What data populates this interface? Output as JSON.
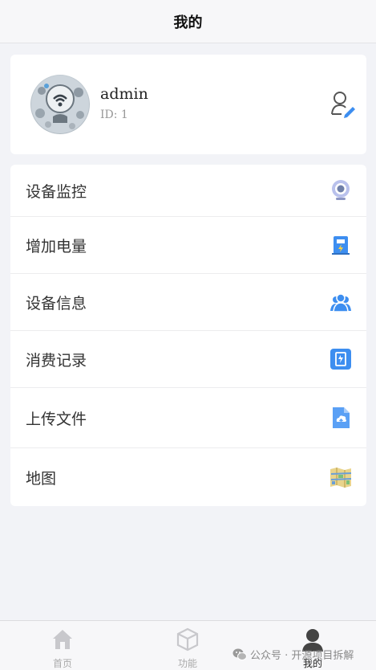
{
  "header": {
    "title": "我的"
  },
  "profile": {
    "name": "admin",
    "id_text": "ID: 1"
  },
  "menu": {
    "items": [
      {
        "label": "设备监控",
        "icon": "camera-icon"
      },
      {
        "label": "增加电量",
        "icon": "charging-station-icon"
      },
      {
        "label": "设备信息",
        "icon": "users-icon"
      },
      {
        "label": "消费记录",
        "icon": "record-doc-icon"
      },
      {
        "label": "上传文件",
        "icon": "cloud-upload-file-icon"
      },
      {
        "label": "地图",
        "icon": "map-icon"
      }
    ]
  },
  "tabbar": {
    "tabs": [
      {
        "label": "首页",
        "icon": "home-icon",
        "active": false
      },
      {
        "label": "功能",
        "icon": "cube-icon",
        "active": false
      },
      {
        "label": "我的",
        "icon": "person-icon",
        "active": true
      }
    ]
  },
  "watermark": {
    "text": "公众号 · 开源项目拆解"
  },
  "colors": {
    "accent_blue": "#3d8ef0",
    "background": "#f2f3f7",
    "card": "#ffffff"
  }
}
